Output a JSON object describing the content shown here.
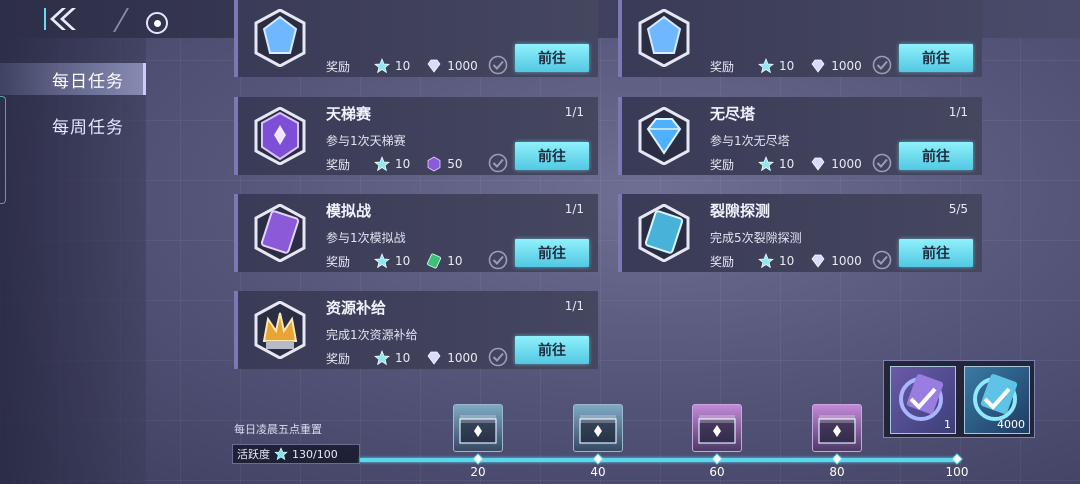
{
  "sidebar": {
    "tabs": [
      {
        "label": "每日任务",
        "active": true
      },
      {
        "label": "每周任务",
        "active": false
      }
    ]
  },
  "reward_label": "奖励",
  "go_label": "前往",
  "quests": [
    {
      "title": "",
      "desc": "",
      "progress": "",
      "icon": "blue-crystal-icon",
      "rewards": [
        {
          "icon": "star-badge-icon",
          "value": "10"
        },
        {
          "icon": "diamond-icon",
          "value": "1000"
        }
      ]
    },
    {
      "title": "",
      "desc": "",
      "progress": "",
      "icon": "blue-crystal-icon",
      "rewards": [
        {
          "icon": "star-badge-icon",
          "value": "10"
        },
        {
          "icon": "diamond-icon",
          "value": "1000"
        }
      ]
    },
    {
      "title": "天梯赛",
      "desc": "参与1次天梯赛",
      "progress": "1/1",
      "icon": "purple-hex-emblem-icon",
      "rewards": [
        {
          "icon": "star-badge-icon",
          "value": "10"
        },
        {
          "icon": "purple-hex-token-icon",
          "value": "50"
        }
      ]
    },
    {
      "title": "无尽塔",
      "desc": "参与1次无尽塔",
      "progress": "1/1",
      "icon": "blue-diamond-icon",
      "rewards": [
        {
          "icon": "star-badge-icon",
          "value": "10"
        },
        {
          "icon": "diamond-icon",
          "value": "1000"
        }
      ]
    },
    {
      "title": "模拟战",
      "desc": "参与1次模拟战",
      "progress": "1/1",
      "icon": "purple-ticket-icon",
      "rewards": [
        {
          "icon": "star-badge-icon",
          "value": "10"
        },
        {
          "icon": "green-ticket-icon",
          "value": "10"
        }
      ]
    },
    {
      "title": "裂隙探测",
      "desc": "完成5次裂隙探测",
      "progress": "5/5",
      "icon": "blue-ticket-icon",
      "rewards": [
        {
          "icon": "star-badge-icon",
          "value": "10"
        },
        {
          "icon": "diamond-icon",
          "value": "1000"
        }
      ]
    },
    {
      "title": "资源补给",
      "desc": "完成1次资源补给",
      "progress": "1/1",
      "icon": "golden-crown-icon",
      "rewards": [
        {
          "icon": "star-badge-icon",
          "value": "10"
        },
        {
          "icon": "diamond-icon",
          "value": "1000"
        }
      ]
    }
  ],
  "bottom": {
    "reset_note": "每日凌晨五点重置",
    "activity_label": "活跃度",
    "activity_value": "130/100",
    "activity_progress": 1.0,
    "milestones": [
      "20",
      "40",
      "60",
      "80",
      "100"
    ]
  },
  "popup": {
    "items": [
      {
        "icon": "purple-ticket-icon",
        "count": "1"
      },
      {
        "icon": "blue-ticket-icon",
        "count": "4000"
      }
    ]
  },
  "colors": {
    "button": "#6fe0f0",
    "accent": "#5ad7ee"
  }
}
